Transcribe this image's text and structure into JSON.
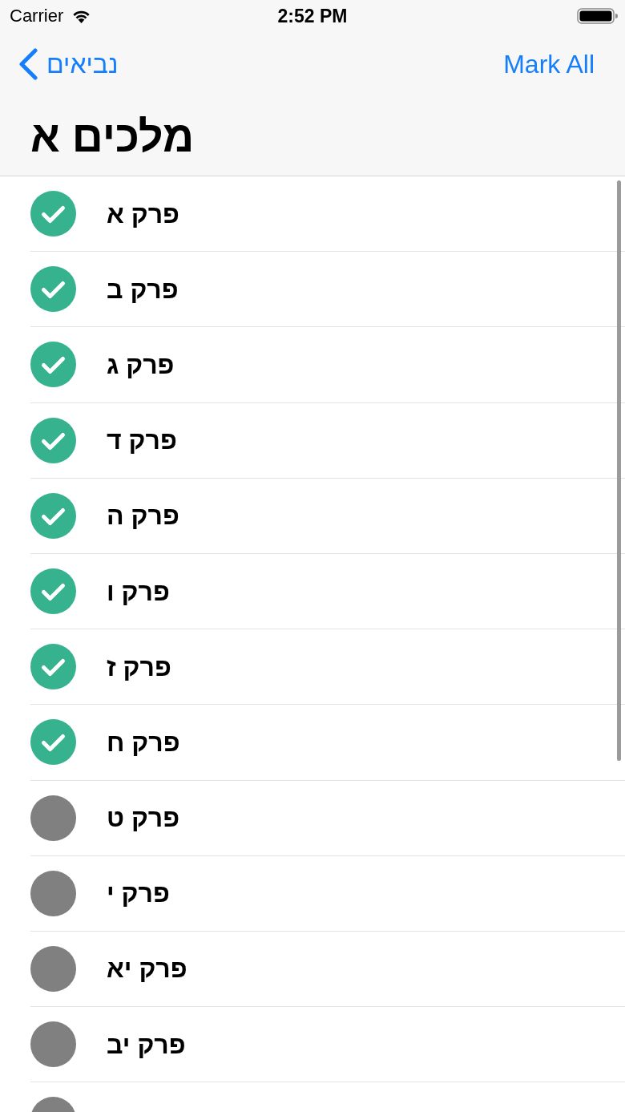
{
  "status_bar": {
    "carrier": "Carrier",
    "time": "2:52 PM"
  },
  "nav_bar": {
    "back_label": "נביאים",
    "action": "Mark All",
    "title": "מלכים א"
  },
  "chapters": [
    {
      "label": "פרק א",
      "checked": true
    },
    {
      "label": "פרק ב",
      "checked": true
    },
    {
      "label": "פרק ג",
      "checked": true
    },
    {
      "label": "פרק ד",
      "checked": true
    },
    {
      "label": "פרק ה",
      "checked": true
    },
    {
      "label": "פרק ו",
      "checked": true
    },
    {
      "label": "פרק ז",
      "checked": true
    },
    {
      "label": "פרק ח",
      "checked": true
    },
    {
      "label": "פרק ט",
      "checked": false
    },
    {
      "label": "פרק י",
      "checked": false
    },
    {
      "label": "פרק יא",
      "checked": false
    },
    {
      "label": "פרק יב",
      "checked": false
    },
    {
      "checked": false
    }
  ]
}
